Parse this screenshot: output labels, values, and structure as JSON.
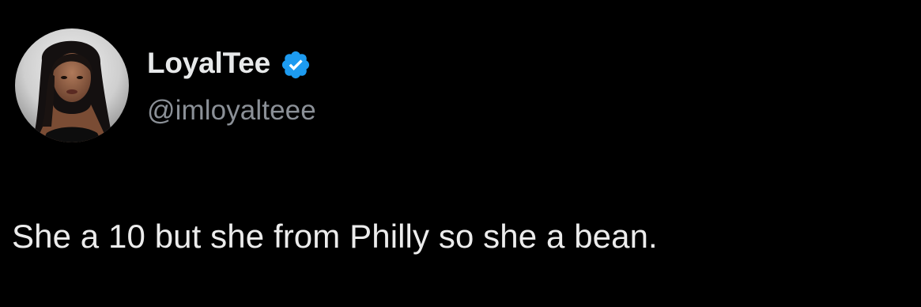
{
  "tweet": {
    "author": {
      "display_name": "LoyalTee",
      "handle": "@imloyalteee",
      "verified": true,
      "avatar_icon": "profile-photo",
      "verified_icon": "verified-badge-icon"
    },
    "text": "She a 10 but she from Philly so she a bean."
  },
  "colors": {
    "background": "#000000",
    "name_text": "#e7e9ea",
    "handle_text": "#8b9097",
    "verified_badge": "#1d9bf0"
  }
}
